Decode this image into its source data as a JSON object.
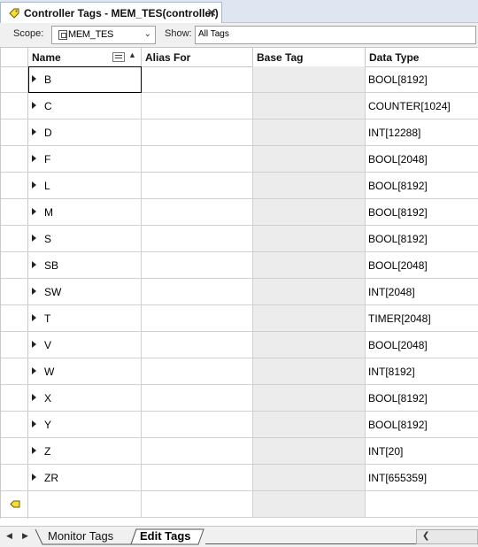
{
  "window": {
    "tab_title": "Controller Tags - MEM_TES(controller)",
    "close_glyph": "✕"
  },
  "toolbar": {
    "scope_label": "Scope:",
    "scope_value": "MEM_TES",
    "show_label": "Show:",
    "show_value": "All Tags"
  },
  "grid": {
    "columns": [
      "Name",
      "Alias For",
      "Base Tag",
      "Data Type"
    ],
    "rows": [
      {
        "name": "B",
        "type": "BOOL[8192]"
      },
      {
        "name": "C",
        "type": "COUNTER[1024]"
      },
      {
        "name": "D",
        "type": "INT[12288]"
      },
      {
        "name": "F",
        "type": "BOOL[2048]"
      },
      {
        "name": "L",
        "type": "BOOL[8192]"
      },
      {
        "name": "M",
        "type": "BOOL[8192]"
      },
      {
        "name": "S",
        "type": "BOOL[8192]"
      },
      {
        "name": "SB",
        "type": "BOOL[2048]"
      },
      {
        "name": "SW",
        "type": "INT[2048]"
      },
      {
        "name": "T",
        "type": "TIMER[2048]"
      },
      {
        "name": "V",
        "type": "BOOL[2048]"
      },
      {
        "name": "W",
        "type": "INT[8192]"
      },
      {
        "name": "X",
        "type": "BOOL[8192]"
      },
      {
        "name": "Y",
        "type": "BOOL[8192]"
      },
      {
        "name": "Z",
        "type": "INT[20]"
      },
      {
        "name": "ZR",
        "type": "INT[655359]"
      }
    ]
  },
  "bottom_tabs": {
    "monitor": "Monitor Tags",
    "edit": "Edit Tags"
  },
  "colors": {
    "accent_tag_icon": "#e8c400",
    "base_col_bg": "#ececec"
  }
}
